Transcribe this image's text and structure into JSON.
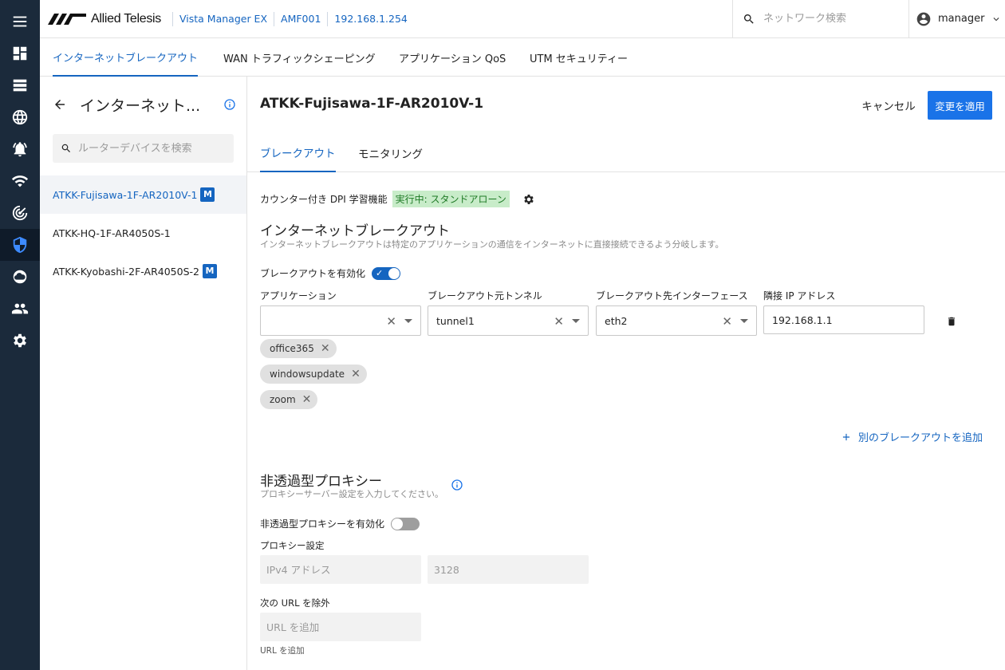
{
  "header": {
    "logo_text": "Allied Telesis",
    "breadcrumbs": [
      "Vista Manager EX",
      "AMF001",
      "192.168.1.254"
    ],
    "search_placeholder": "ネットワーク検索",
    "user": "manager"
  },
  "rail": {
    "icons": [
      "menu-icon",
      "dashboard-icon",
      "list-icon",
      "globe-icon",
      "alarm-icon",
      "wifi-icon",
      "radar-icon",
      "security-shield-icon",
      "cloud-icon",
      "users-icon",
      "settings-icon"
    ],
    "active": "security-shield-icon"
  },
  "top_tabs": [
    {
      "label": "インターネットブレークアウト",
      "active": true
    },
    {
      "label": "WAN トラフィックシェーピング",
      "active": false
    },
    {
      "label": "アプリケーション QoS",
      "active": false
    },
    {
      "label": "UTM セキュリティー",
      "active": false
    }
  ],
  "sidebar": {
    "title": "インターネット...",
    "search_placeholder": "ルーターデバイスを検索",
    "devices": [
      {
        "name": "ATKK-Fujisawa-1F-AR2010V-1",
        "badge": "M",
        "active": true
      },
      {
        "name": "ATKK-HQ-1F-AR4050S-1",
        "badge": "",
        "active": false
      },
      {
        "name": "ATKK-Kyobashi-2F-AR4050S-2",
        "badge": "M",
        "active": false
      }
    ]
  },
  "main": {
    "device_title": "ATKK-Fujisawa-1F-AR2010V-1",
    "cancel_label": "キャンセル",
    "apply_label": "変更を適用",
    "tabs": [
      {
        "label": "ブレークアウト",
        "active": true
      },
      {
        "label": "モニタリング",
        "active": false
      }
    ],
    "dpi": {
      "label": "カウンター付き DPI 学習機能",
      "status": "実行中: スタンドアローン"
    },
    "breakout": {
      "title": "インターネットブレークアウト",
      "description": "インターネットブレークアウトは特定のアプリケーションの通信をインターネットに直接接続できるよう分岐します。",
      "enable_label": "ブレークアウトを有効化",
      "enabled": true,
      "columns": {
        "application": "アプリケーション",
        "tunnel": "ブレークアウト元トンネル",
        "interface": "ブレークアウト先インターフェース",
        "neighbor_ip": "隣接 IP アドレス"
      },
      "row": {
        "application": "",
        "tunnel": "tunnel1",
        "interface": "eth2",
        "neighbor_ip": "192.168.1.1"
      },
      "chips": [
        "office365",
        "windowsupdate",
        "zoom"
      ],
      "add_label": "別のブレークアウトを追加"
    },
    "proxy": {
      "title": "非透過型プロキシー",
      "description": "プロキシーサーバー設定を入力してください。",
      "enable_label": "非透過型プロキシーを有効化",
      "enabled": false,
      "settings_label": "プロキシー設定",
      "ipv4_placeholder": "IPv4 アドレス",
      "port_placeholder": "3128",
      "exclude_label": "次の URL を除外",
      "url_placeholder": "URL を追加",
      "url_helper": "URL を追加"
    }
  }
}
